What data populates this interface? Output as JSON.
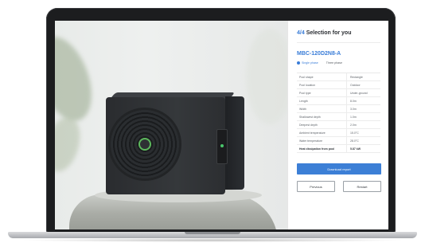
{
  "panel": {
    "step": "4/4",
    "title": "Selection for you",
    "model": "MBC-120D2N8-A",
    "phases": [
      {
        "label": "Single phase",
        "selected": true
      },
      {
        "label": "Three phase",
        "selected": false
      }
    ],
    "specs": [
      {
        "key": "Pool shape",
        "value": "Rectangle",
        "bold": false
      },
      {
        "key": "Pool location",
        "value": "Outdoor",
        "bold": false
      },
      {
        "key": "Pool type",
        "value": "Under-ground",
        "bold": false
      },
      {
        "key": "Length",
        "value": "8.0m",
        "bold": false
      },
      {
        "key": "Width",
        "value": "3.0m",
        "bold": false
      },
      {
        "key": "Shallowest depth",
        "value": "1.0m",
        "bold": false
      },
      {
        "key": "Deepest depth",
        "value": "2.0m",
        "bold": false
      },
      {
        "key": "Ambient temperature",
        "value": "15.0°C",
        "bold": false
      },
      {
        "key": "Water temperature",
        "value": "28.0°C",
        "bold": false
      },
      {
        "key": "Heat dissipation from pool",
        "value": "5.87 kW",
        "bold": true
      }
    ],
    "download_label": "Download report",
    "previous_label": "Previous",
    "restart_label": "Restart",
    "accent_color": "#3c7fd6"
  }
}
